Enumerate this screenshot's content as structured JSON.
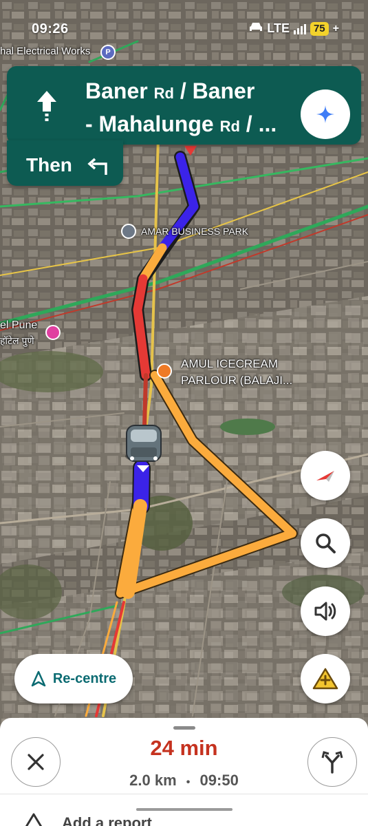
{
  "status_bar": {
    "time": "09:26",
    "network": "LTE",
    "battery": "75"
  },
  "nav": {
    "street_line1_main": "Baner",
    "street_line1_suffix": "Rd",
    "street_line1_rest": "/ Baner",
    "street_line2_main": "- Mahalunge",
    "street_line2_suffix": "Rd",
    "street_line2_rest": "/ ...",
    "then_label": "Then"
  },
  "map": {
    "top_place": "hal Electrical Works",
    "amar_label": "AMAR BUSINESS PARK",
    "hotel_label_1": "el Pune",
    "hotel_label_2": "हॉटेल पुणे",
    "amul_label_1": "AMUL ICECREAM",
    "amul_label_2": "PARLOUR (BALAJI...",
    "route_colors": {
      "traffic_heavy": "#e53935",
      "traffic_slow": "#fbab3d",
      "route_clear": "#3b23e8"
    }
  },
  "controls": {
    "recentre_label": "Re-centre",
    "compass_icon": "compass-icon",
    "search_icon": "search-icon",
    "sound_icon": "volume-icon",
    "report_icon": "add-report-icon"
  },
  "trip": {
    "eta_minutes": "24 min",
    "distance": "2.0 km",
    "separator": "•",
    "arrival_time": "09:50",
    "report_label": "Add a report"
  }
}
